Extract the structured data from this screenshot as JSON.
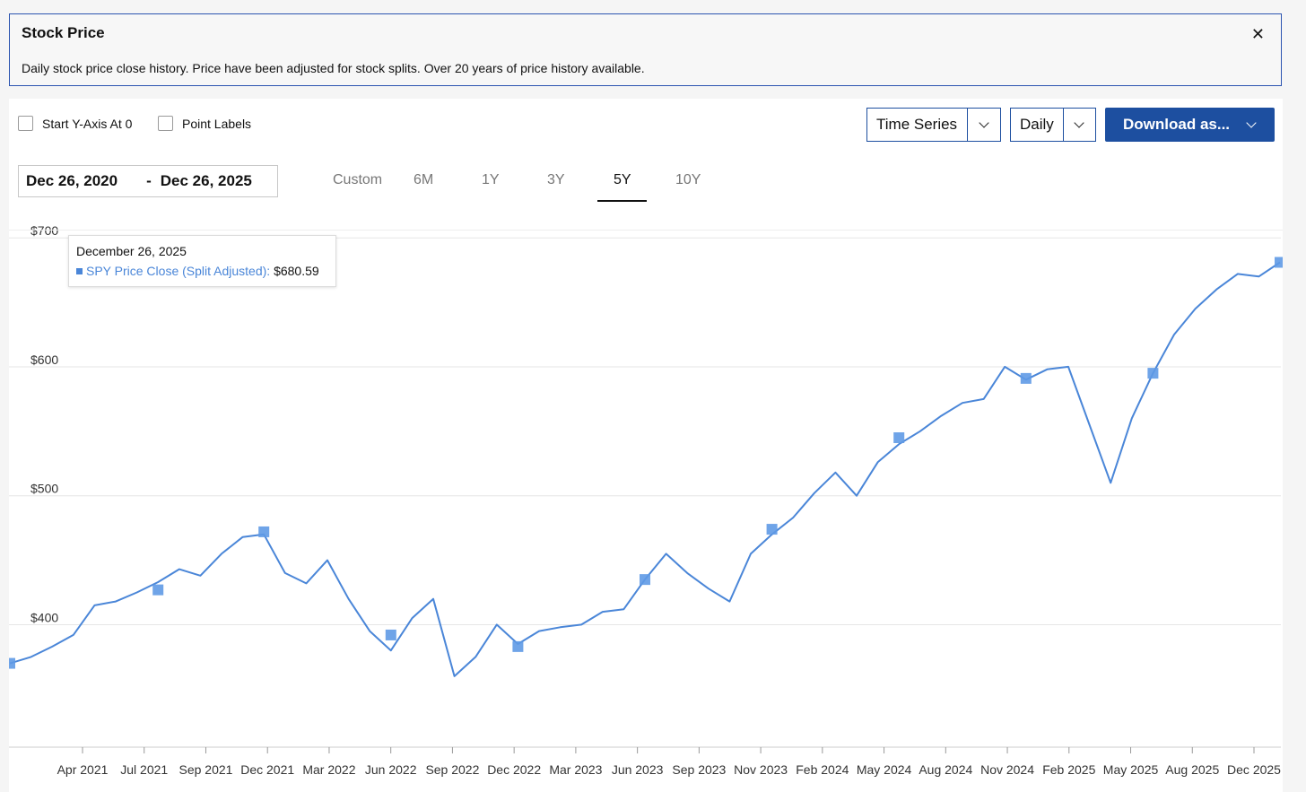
{
  "panel": {
    "title": "Stock Price",
    "description": "Daily stock price close history. Price have been adjusted for stock splits. Over 20 years of price history available.",
    "close_icon": "close-icon"
  },
  "controls": {
    "start_y_axis_label": "Start Y-Axis At 0",
    "start_y_axis_checked": false,
    "point_labels_label": "Point Labels",
    "point_labels_checked": false,
    "chart_type_value": "Time Series",
    "frequency_value": "Daily",
    "download_label": "Download as...",
    "date_from": "Dec 26, 2020",
    "date_separator": "-",
    "date_to": "Dec 26, 2025",
    "range_tabs": [
      "Custom",
      "6M",
      "1Y",
      "3Y",
      "5Y",
      "10Y"
    ],
    "active_range": "5Y"
  },
  "tooltip": {
    "date": "December 26, 2025",
    "series": "SPY Price Close (Split Adjusted):",
    "value": "$680.59"
  },
  "colors": {
    "accent": "#1d4fa0",
    "series_line": "#4a86d8",
    "series_marker": "#5f9ae6"
  },
  "chart_data": {
    "type": "line",
    "title": "",
    "xlabel": "",
    "ylabel": "",
    "ylim": [
      305,
      705
    ],
    "yticks": [
      400,
      500,
      600,
      700
    ],
    "ytick_labels": [
      "$400",
      "$500",
      "$600",
      "$700"
    ],
    "xtick_labels": [
      "Apr 2021",
      "Jul 2021",
      "Sep 2021",
      "Dec 2021",
      "Mar 2022",
      "Jun 2022",
      "Sep 2022",
      "Dec 2022",
      "Mar 2023",
      "Jun 2023",
      "Sep 2023",
      "Nov 2023",
      "Feb 2024",
      "May 2024",
      "Aug 2024",
      "Nov 2024",
      "Feb 2025",
      "May 2025",
      "Aug 2025",
      "Dec 2025"
    ],
    "grid": true,
    "legend": "none",
    "series": [
      {
        "name": "SPY Price Close (Split Adjusted)",
        "x": [
          "Dec 2020",
          "Jan 2021",
          "Feb 2021",
          "Mar 2021",
          "Apr 2021",
          "May 2021",
          "Jun 2021",
          "Jul 2021",
          "Aug 2021",
          "Sep 2021",
          "Oct 2021",
          "Nov 2021",
          "Dec 2021",
          "Jan 2022",
          "Feb 2022",
          "Mar 2022",
          "Apr 2022",
          "May 2022",
          "Jun 2022",
          "Jul 2022",
          "Aug 2022",
          "Sep 2022",
          "Oct 2022",
          "Nov 2022",
          "Dec 2022",
          "Jan 2023",
          "Feb 2023",
          "Mar 2023",
          "Apr 2023",
          "May 2023",
          "Jun 2023",
          "Jul 2023",
          "Aug 2023",
          "Sep 2023",
          "Oct 2023",
          "Nov 2023",
          "Dec 2023",
          "Jan 2024",
          "Feb 2024",
          "Mar 2024",
          "Apr 2024",
          "May 2024",
          "Jun 2024",
          "Jul 2024",
          "Aug 2024",
          "Sep 2024",
          "Oct 2024",
          "Nov 2024",
          "Dec 2024",
          "Jan 2025",
          "Feb 2025",
          "Mar 2025",
          "Apr 2025",
          "May 2025",
          "Jun 2025",
          "Jul 2025",
          "Aug 2025",
          "Sep 2025",
          "Oct 2025",
          "Nov 2025",
          "Dec 2025"
        ],
        "values": [
          370,
          375,
          383,
          392,
          415,
          418,
          425,
          433,
          443,
          438,
          455,
          468,
          470,
          440,
          432,
          450,
          420,
          395,
          380,
          405,
          420,
          360,
          375,
          400,
          385,
          395,
          398,
          400,
          410,
          412,
          435,
          455,
          440,
          428,
          418,
          455,
          470,
          483,
          502,
          518,
          500,
          526,
          540,
          550,
          562,
          572,
          575,
          600,
          590,
          598,
          600,
          555,
          510,
          560,
          595,
          625,
          645,
          660,
          672,
          670,
          681
        ],
        "markers": [
          {
            "x": "Dec 2020",
            "value": 370
          },
          {
            "x": "Jul 2021",
            "value": 427
          },
          {
            "x": "Dec 2021",
            "value": 472
          },
          {
            "x": "Jun 2022",
            "value": 392
          },
          {
            "x": "Dec 2022",
            "value": 383
          },
          {
            "x": "Jun 2023",
            "value": 435
          },
          {
            "x": "Dec 2023",
            "value": 474
          },
          {
            "x": "Jun 2024",
            "value": 545
          },
          {
            "x": "Dec 2024",
            "value": 591
          },
          {
            "x": "Jun 2025",
            "value": 595
          },
          {
            "x": "Dec 2025",
            "value": 681
          }
        ]
      }
    ]
  }
}
